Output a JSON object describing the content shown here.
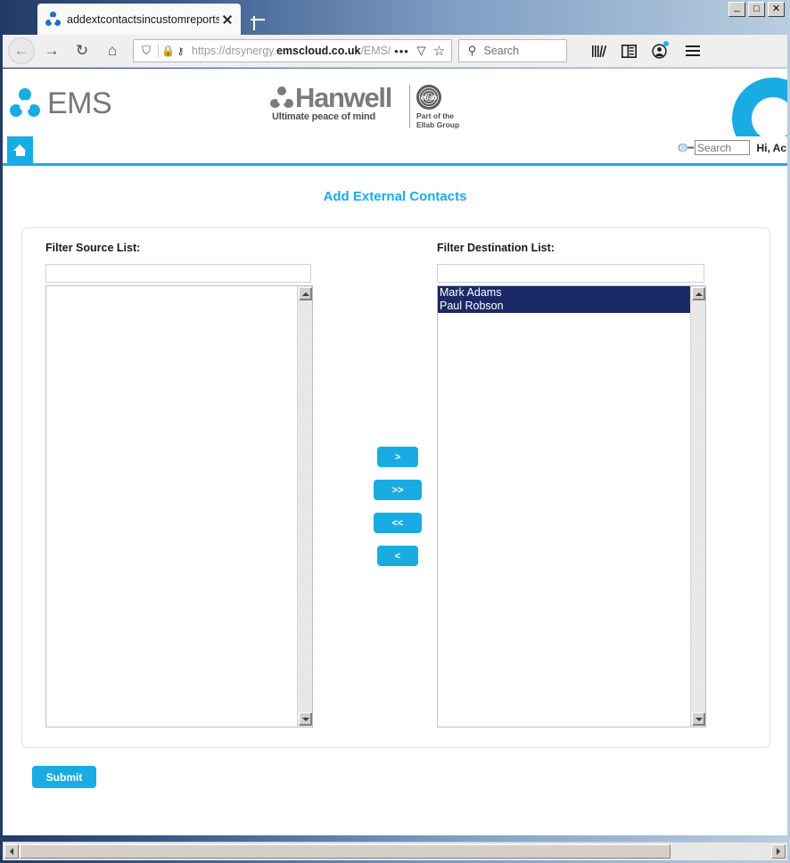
{
  "browser": {
    "tab": {
      "title": "addextcontactsincustomreports",
      "favicon": "ems-trefoil-icon",
      "close_label": "",
      "new_tab_label": ""
    },
    "window_controls": {
      "minimize": "_",
      "maximize": "□",
      "close": "✕"
    },
    "toolbar": {
      "back": "←",
      "forward": "→",
      "reload": "↻",
      "home": "⌂",
      "shield": "⛉",
      "lock": "🔒",
      "permissions": "⚷",
      "url_prefix": "https://drsynergy.",
      "url_domain": "emscloud.co.uk",
      "url_suffix": "/EMS/",
      "page_actions": "•••",
      "pocket": "▽",
      "bookmark": "☆",
      "search_icon": "⚲",
      "search_placeholder": "Search",
      "library": "library-icon",
      "sidebar": "sidebar-icon",
      "account": "account-icon",
      "menu": "menu-icon"
    }
  },
  "site": {
    "brand": {
      "ems_name": "EMS",
      "hanwell_name": "Hanwell",
      "hanwell_tagline": "Ultimate peace of mind",
      "ellab_mark": "ellab",
      "ellab_caption_line1": "Part of the",
      "ellab_caption_line2": "Ellab Group"
    },
    "navbar": {
      "home_label": "Home",
      "search_placeholder": "Search",
      "greeting": "Hi, Ac"
    },
    "page_title": "Add External Contacts",
    "colors": {
      "accent": "#19ace3",
      "selection": "#1b2a66",
      "logo_grey": "#777779"
    }
  },
  "form": {
    "source": {
      "label": "Filter Source List:",
      "filter_value": "",
      "filter_placeholder": "",
      "items": []
    },
    "destination": {
      "label": "Filter Destination List:",
      "filter_value": "",
      "filter_placeholder": "",
      "items": [
        {
          "name": "Mark Adams",
          "selected": true
        },
        {
          "name": "Paul Robson",
          "selected": true
        }
      ]
    },
    "transfer_buttons": {
      "move_one": ">",
      "move_all": ">>",
      "remove_all": "<<",
      "remove_one": "<"
    },
    "submit_label": "Submit"
  }
}
